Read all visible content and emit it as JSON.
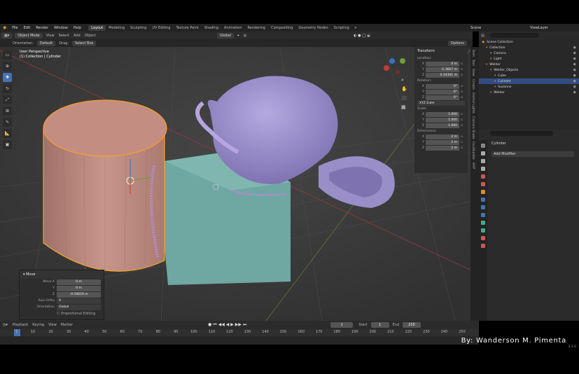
{
  "menu": [
    "File",
    "Edit",
    "Render",
    "Window",
    "Help"
  ],
  "workspaces": [
    "Layout",
    "Modeling",
    "Sculpting",
    "UV Editing",
    "Texture Paint",
    "Shading",
    "Animation",
    "Rendering",
    "Compositing",
    "Geometry Nodes",
    "Scripting"
  ],
  "active_workspace": "Layout",
  "scene": {
    "label": "Scene",
    "view_layer": "ViewLayer"
  },
  "header": {
    "mode": "Object Mode",
    "menus": [
      "View",
      "Select",
      "Add",
      "Object"
    ],
    "transform": "Global"
  },
  "header2": {
    "orientation_label": "Orientation:",
    "orientation_value": "Default",
    "drag_label": "Drag:",
    "drag_value": "Select Box",
    "options": "Options"
  },
  "viewport": {
    "title": "User Perspective",
    "subtitle": "(1) Collection | Cylinder"
  },
  "npanel": {
    "title": "Transform",
    "location_label": "Location:",
    "location": [
      {
        "k": "X",
        "v": "0 m"
      },
      {
        "k": "Y",
        "v": "-1.3667 m"
      },
      {
        "k": "Z",
        "v": "0.34301 m"
      }
    ],
    "rotation_label": "Rotation:",
    "rotation": [
      {
        "k": "X",
        "v": "0°"
      },
      {
        "k": "Y",
        "v": "0°"
      },
      {
        "k": "Z",
        "v": "0°"
      }
    ],
    "rotation_mode": "XYZ Euler",
    "scale_label": "Scale:",
    "scale": [
      {
        "k": "X",
        "v": "1.000"
      },
      {
        "k": "Y",
        "v": "1.000"
      },
      {
        "k": "Z",
        "v": "1.000"
      }
    ],
    "dimensions_label": "Dimensions:",
    "dimensions": [
      {
        "k": "X",
        "v": "2 m"
      },
      {
        "k": "Y",
        "v": "2 m"
      },
      {
        "k": "Z",
        "v": "2 m"
      }
    ]
  },
  "ntabs": [
    "Item",
    "Tool",
    "View",
    "Create",
    "Dental Lights",
    "Camera Shake",
    "FaceBuilder",
    "ARP"
  ],
  "operator": {
    "title": "Move",
    "rows": [
      {
        "k": "Move X",
        "v": "0 m"
      },
      {
        "k": "Y",
        "v": "0 m"
      },
      {
        "k": "Z",
        "v": "-0.59819 m"
      }
    ],
    "axis_label": "Axis Ortho",
    "axis_value": "X",
    "orient_label": "Orientation",
    "orient_value": "Global",
    "prop_label": "Proportional Editing"
  },
  "outliner": [
    {
      "label": "Scene Collection",
      "indent": 0
    },
    {
      "label": "Collection",
      "indent": 1
    },
    {
      "label": "Camera",
      "indent": 2
    },
    {
      "label": "Light",
      "indent": 2
    },
    {
      "label": "Welder",
      "indent": 1
    },
    {
      "label": "Welder_Objects",
      "indent": 2
    },
    {
      "label": "Cube",
      "indent": 3
    },
    {
      "label": "Cylinder",
      "indent": 3,
      "selected": true
    },
    {
      "label": "Suzanne",
      "indent": 3
    },
    {
      "label": "Welder",
      "indent": 2
    }
  ],
  "properties": {
    "object": "Cylinder",
    "add_modifier": "Add Modifier"
  },
  "timeline": {
    "menus": [
      "Playback",
      "Keying",
      "View",
      "Marker"
    ],
    "current": "1",
    "start_label": "Start",
    "start": "1",
    "end_label": "End",
    "end": "250",
    "ticks": [
      "1",
      "10",
      "20",
      "30",
      "40",
      "50",
      "60",
      "70",
      "80",
      "90",
      "100",
      "110",
      "120",
      "130",
      "140",
      "150",
      "160",
      "170",
      "180",
      "190",
      "200",
      "210",
      "220",
      "230",
      "240",
      "250"
    ]
  },
  "credit": "By: Wanderson M. Pimenta",
  "version": "3.3.0",
  "colors": {
    "accent": "#4772b3",
    "cylinder": "#c08c80",
    "cube": "#6fa7a2",
    "suzanne": "#9a8ec8",
    "highlight": "#f5a22a"
  }
}
